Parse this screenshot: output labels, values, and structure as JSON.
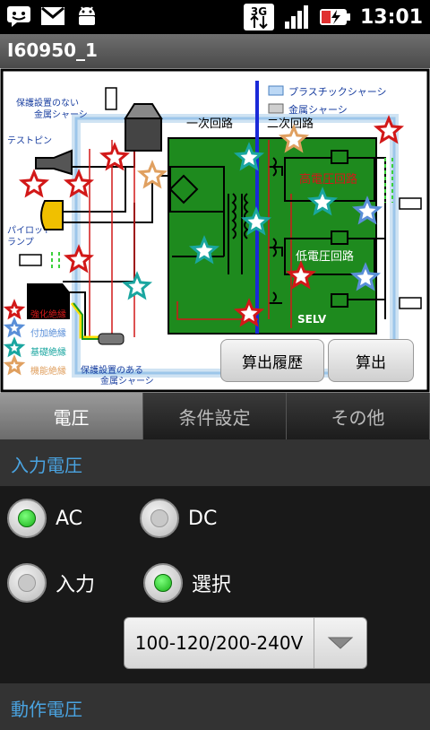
{
  "status": {
    "time": "13:01",
    "network": "3G"
  },
  "title": "I60950_1",
  "diagram": {
    "legend_plastic": "プラスチックシャーシ",
    "legend_metal": "金属シャーシ",
    "primary": "一次回路",
    "secondary": "二次回路",
    "unprotected_chassis": [
      "保護設置のない",
      "金属シャーシ"
    ],
    "test_pin": "テストピン",
    "pilot_lamp": [
      "パイロット",
      "ランプ"
    ],
    "high_voltage": "高電圧回路",
    "low_voltage": "低電圧回路",
    "selv": "SELV",
    "legend_reinforced": "強化絶縁",
    "legend_supplementary": "付加絶縁",
    "legend_basic": "基礎絶縁",
    "legend_functional": "機能絶縁",
    "protected_chassis": [
      "保護設置のある",
      "金属シャーシ"
    ],
    "btn_history": "算出履歴",
    "btn_calc": "算出"
  },
  "tabs": [
    {
      "label": "電圧",
      "active": true
    },
    {
      "label": "条件設定",
      "active": false
    },
    {
      "label": "その他",
      "active": false
    }
  ],
  "input_voltage": {
    "header": "入力電圧",
    "type_options": [
      {
        "label": "AC",
        "checked": true
      },
      {
        "label": "DC",
        "checked": false
      }
    ],
    "mode_options": [
      {
        "label": "入力",
        "checked": false
      },
      {
        "label": "選択",
        "checked": true
      }
    ],
    "selected_range": "100-120/200-240V"
  },
  "operating_voltage": {
    "header": "動作電圧"
  },
  "colors": {
    "accent": "#4aa3e0",
    "board": "#1e8a1e",
    "star_red": "#d21818",
    "star_teal": "#1aa6a0",
    "star_blue": "#5a8fd8",
    "star_tan": "#e0a060"
  }
}
